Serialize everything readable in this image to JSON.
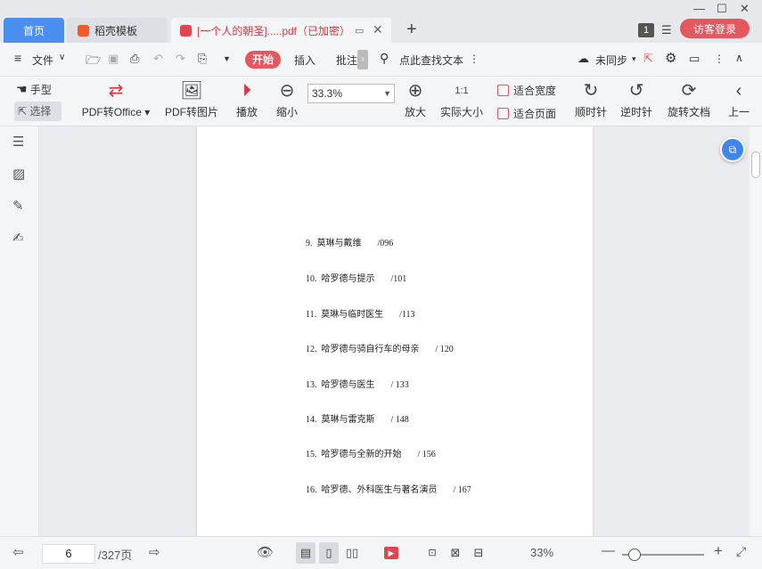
{
  "tabs": [
    {
      "label": "首页"
    },
    {
      "label": "稻壳模板"
    },
    {
      "label": "[一个人的朝圣].....pdf（已加密）"
    }
  ],
  "titlebar": {
    "page_badge": "1",
    "login_label": "访客登录"
  },
  "menubar": {
    "file": "文件",
    "start": "开始",
    "insert": "插入",
    "annotate": "批注",
    "search": "点此查找文本",
    "sync": "未同步"
  },
  "toolbar": {
    "hand": "手型",
    "select": "选择",
    "pdf_to_office": "PDF转Office",
    "pdf_to_image": "PDF转图片",
    "play": "播放",
    "zoom_out": "缩小",
    "zoom_value": "33.3%",
    "zoom_in": "放大",
    "actual_size": "实际大小",
    "actual_size_glyph": "1:1",
    "fit_width": "适合宽度",
    "fit_page": "适合页面",
    "rotate_cw": "顺时针",
    "rotate_ccw": "逆时针",
    "rotate_doc": "旋转文档",
    "prev": "上一"
  },
  "toc": [
    {
      "num": "9.",
      "title": "莫琳与戴维",
      "page": "/096"
    },
    {
      "num": "10.",
      "title": "哈罗德与提示",
      "page": "/101"
    },
    {
      "num": "11.",
      "title": "莫琳与临时医生",
      "page": "/113"
    },
    {
      "num": "12.",
      "title": "哈罗德与骑自行车的母亲",
      "page": "/ 120"
    },
    {
      "num": "13.",
      "title": "哈罗德与医生",
      "page": "/ 133"
    },
    {
      "num": "14.",
      "title": "莫琳与雷克斯",
      "page": "/ 148"
    },
    {
      "num": "15.",
      "title": "哈罗德与全新的开始",
      "page": "/ 156"
    },
    {
      "num": "16.",
      "title": "哈罗德、外科医生与著名演员",
      "page": "/ 167"
    }
  ],
  "status": {
    "current_page": "6",
    "total_pages": "/327页",
    "zoom": "33%",
    "slider_fraction": 0.15
  },
  "icons": {
    "accent_red": "#e2585e",
    "accent_blue": "#4a8ef0"
  }
}
